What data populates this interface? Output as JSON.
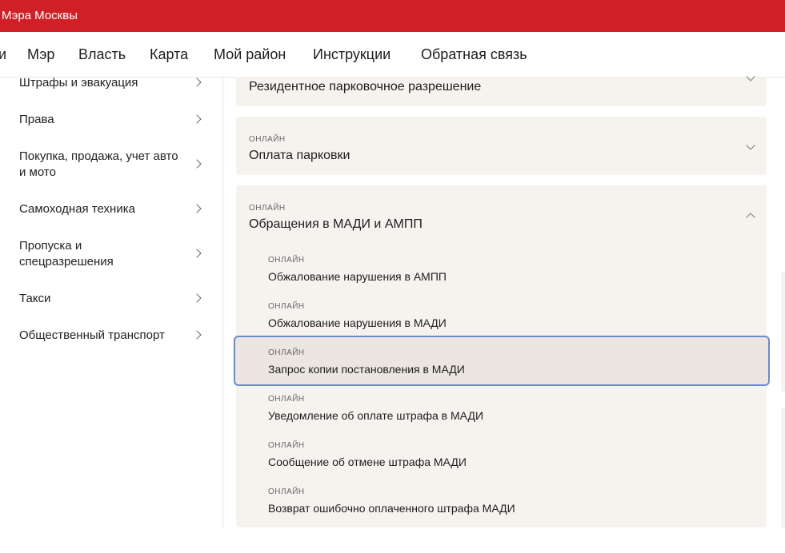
{
  "header": {
    "title": "Мэра Москвы"
  },
  "nav": {
    "items": [
      "и",
      "Мэр",
      "Власть",
      "Карта",
      "Мой район",
      "Инструкции",
      "Обратная связь"
    ]
  },
  "sidebar": {
    "items": [
      {
        "label": "Штрафы и эвакуация"
      },
      {
        "label": "Права"
      },
      {
        "label": "Покупка, продажа, учет авто и мото"
      },
      {
        "label": "Самоходная техника"
      },
      {
        "label": "Пропуска и спецразрешения"
      },
      {
        "label": "Такси"
      },
      {
        "label": "Общественный транспорт"
      }
    ]
  },
  "main": {
    "panels": [
      {
        "title": "Резидентное парковочное разрешение",
        "expanded": false
      },
      {
        "badge": "ОНЛАЙН",
        "title": "Оплата парковки",
        "expanded": false
      },
      {
        "badge": "ОНЛАЙН",
        "title": "Обращения в МАДИ и АМПП",
        "expanded": true,
        "items": [
          {
            "badge": "ОНЛАЙН",
            "title": "Обжалование нарушения в АМПП"
          },
          {
            "badge": "ОНЛАЙН",
            "title": "Обжалование нарушения в МАДИ"
          },
          {
            "badge": "ОНЛАЙН",
            "title": "Запрос копии постановления в МАДИ",
            "focused": true
          },
          {
            "badge": "ОНЛАЙН",
            "title": "Уведомление об оплате штрафа в МАДИ"
          },
          {
            "badge": "ОНЛАЙН",
            "title": "Сообщение об отмене штрафа МАДИ"
          },
          {
            "badge": "ОНЛАЙН",
            "title": "Возврат ошибочно оплаченного штрафа МАДИ"
          }
        ]
      }
    ]
  },
  "colors": {
    "brand_red": "#cf2027",
    "panel_bg": "#f6f3ee",
    "focus_ring": "#6b8ad3"
  }
}
